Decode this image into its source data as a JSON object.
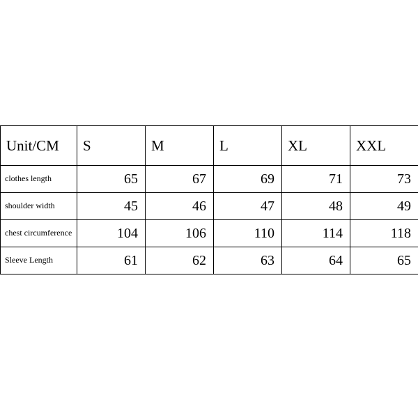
{
  "chart_data": {
    "type": "table",
    "title": "",
    "header_label": "Unit/CM",
    "columns": [
      "S",
      "M",
      "L",
      "XL",
      "XXL"
    ],
    "rows": [
      {
        "label": "clothes length",
        "values": [
          65,
          67,
          69,
          71,
          73
        ]
      },
      {
        "label": "shoulder width",
        "values": [
          45,
          46,
          47,
          48,
          49
        ]
      },
      {
        "label": "chest circumference",
        "values": [
          104,
          106,
          110,
          114,
          118
        ]
      },
      {
        "label": "Sleeve Length",
        "values": [
          61,
          62,
          63,
          64,
          65
        ]
      }
    ]
  }
}
